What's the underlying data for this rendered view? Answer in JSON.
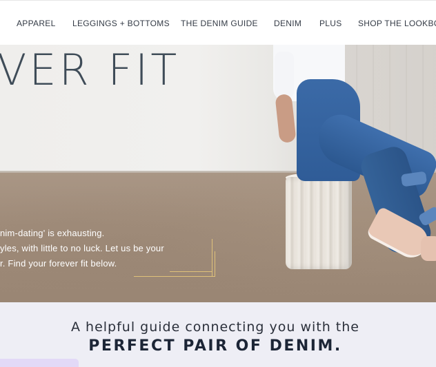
{
  "nav": {
    "items": [
      {
        "label": "APPAREL"
      },
      {
        "label": "LEGGINGS + BOTTOMS"
      },
      {
        "label": "THE DENIM GUIDE"
      },
      {
        "label": "DENIM"
      },
      {
        "label": "PLUS"
      },
      {
        "label": "SHOP THE LOOKBOOK"
      }
    ]
  },
  "hero": {
    "title": "VER FIT",
    "body_lines": [
      "nim-dating' is exhausting.",
      "yles, with little to no luck. Let us be your",
      "r. Find your forever fit below."
    ]
  },
  "band": {
    "line1": "A helpful guide connecting you with the",
    "line2": "PERFECT PAIR OF DENIM."
  },
  "colors": {
    "title": "#3f4c58",
    "accent_frame": "#e0c27a",
    "band_bg": "#eeeef5",
    "denim": "#2f5c97"
  }
}
